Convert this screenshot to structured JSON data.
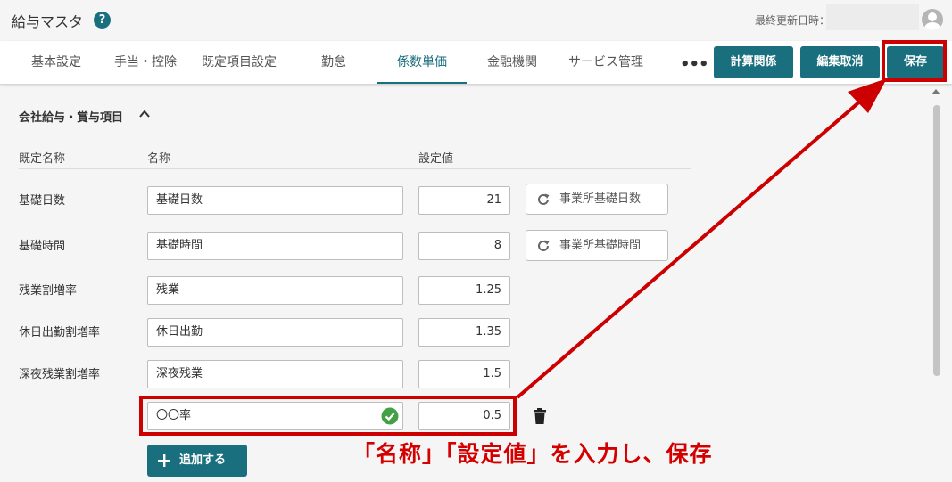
{
  "app": {
    "title": "給与マスタ",
    "help_icon_glyph": "?",
    "last_updated_label": "最終更新日時："
  },
  "tabs": [
    {
      "label": "基本設定",
      "active": false
    },
    {
      "label": "手当・控除",
      "active": false
    },
    {
      "label": "既定項目設定",
      "active": false
    },
    {
      "label": "勤怠",
      "active": false
    },
    {
      "label": "係数単価",
      "active": true
    },
    {
      "label": "金融機関",
      "active": false
    },
    {
      "label": "サービス管理",
      "active": false
    }
  ],
  "more_glyph": "•••",
  "toolbar": {
    "calc_label": "計算関係",
    "cancel_label": "編集取消",
    "save_label": "保存"
  },
  "section": {
    "title": "会社給与・賞与項目",
    "headers": {
      "default_name": "既定名称",
      "name": "名称",
      "value": "設定値"
    }
  },
  "rows": [
    {
      "default_name": "基礎日数",
      "name": "基礎日数",
      "value": "21",
      "reset_label": "事業所基礎日数"
    },
    {
      "default_name": "基礎時間",
      "name": "基礎時間",
      "value": "8",
      "reset_label": "事業所基礎時間"
    },
    {
      "default_name": "残業割増率",
      "name": "残業",
      "value": "1.25"
    },
    {
      "default_name": "休日出勤割増率",
      "name": "休日出勤",
      "value": "1.35"
    },
    {
      "default_name": "深夜残業割増率",
      "name": "深夜残業",
      "value": "1.5"
    },
    {
      "default_name": "",
      "name": "〇〇率",
      "value": "0.5"
    }
  ],
  "add_button_label": "追加する",
  "annotation_text": "「名称」「設定値」を入力し、保存",
  "colors": {
    "accent": "#1a6f7e",
    "highlight": "#cc0000",
    "success": "#43a047"
  },
  "icons": [
    "help-icon",
    "avatar-icon",
    "more-icon",
    "chevron-up-icon",
    "refresh-icon",
    "check-circle-icon",
    "trash-icon",
    "plus-icon"
  ]
}
